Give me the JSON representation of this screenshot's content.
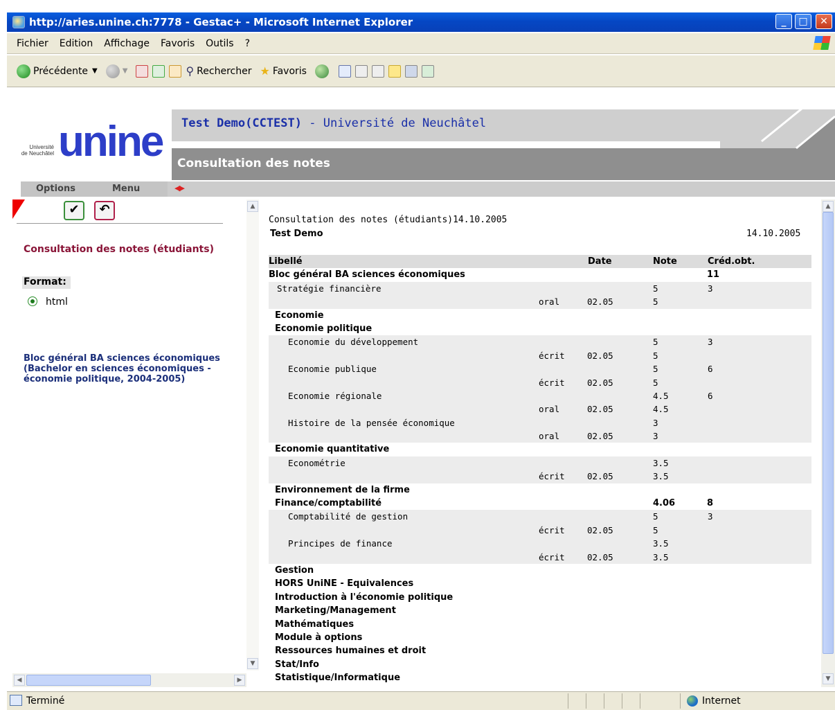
{
  "window": {
    "title": "http://aries.unine.ch:7778 - Gestac+ - Microsoft Internet Explorer"
  },
  "menu": [
    "Fichier",
    "Edition",
    "Affichage",
    "Favoris",
    "Outils",
    "?"
  ],
  "toolbar": {
    "back": "Précédente",
    "search": "Rechercher",
    "favorites": "Favoris"
  },
  "header": {
    "logo_small_line1": "Université",
    "logo_small_line2": "de Neuchâtel",
    "logo_big": "unine",
    "school_user": "Test Demo(CCTEST)",
    "school_sep": " - ",
    "school_name": "Université de Neuchâtel",
    "page_heading": "Consultation des notes"
  },
  "options_bar": {
    "options": "Options",
    "menu": "Menu"
  },
  "left_panel": {
    "heading": "Consultation des notes (étudiants)",
    "format_label": "Format:",
    "format_value": "html",
    "bloc_link": "Bloc général BA sciences économiques (Bachelor en sciences économiques - économie politique, 2004-2005)"
  },
  "report": {
    "title": "Consultation des notes (étudiants)14.10.2005",
    "student": "Test Demo",
    "date": "14.10.2005",
    "columns": {
      "libelle": "Libellé",
      "date": "Date",
      "note": "Note",
      "credits": "Créd.obt."
    },
    "rows": [
      {
        "type": "sec0",
        "label": "Bloc général BA sciences économiques",
        "type2": "",
        "date": "",
        "note": "",
        "credits": "11"
      },
      {
        "type": "item1",
        "label": "Stratégie financière",
        "type2": "",
        "date": "",
        "note": "5",
        "credits": "3"
      },
      {
        "type": "exam",
        "label": "",
        "type2": "oral",
        "date": "02.05",
        "note": "5",
        "credits": ""
      },
      {
        "type": "sec1",
        "label": "Economie",
        "type2": "",
        "date": "",
        "note": "",
        "credits": ""
      },
      {
        "type": "sec1",
        "label": "Economie politique",
        "type2": "",
        "date": "",
        "note": "",
        "credits": ""
      },
      {
        "type": "item2",
        "label": "Economie du développement",
        "type2": "",
        "date": "",
        "note": "5",
        "credits": "3"
      },
      {
        "type": "exam",
        "label": "",
        "type2": "écrit",
        "date": "02.05",
        "note": "5",
        "credits": ""
      },
      {
        "type": "item2",
        "label": "Economie publique",
        "type2": "",
        "date": "",
        "note": "5",
        "credits": "6"
      },
      {
        "type": "exam",
        "label": "",
        "type2": "écrit",
        "date": "02.05",
        "note": "5",
        "credits": ""
      },
      {
        "type": "item2",
        "label": "Economie régionale",
        "type2": "",
        "date": "",
        "note": "4.5",
        "credits": "6"
      },
      {
        "type": "exam",
        "label": "",
        "type2": "oral",
        "date": "02.05",
        "note": "4.5",
        "credits": ""
      },
      {
        "type": "item2",
        "label": "Histoire de la pensée économique",
        "type2": "",
        "date": "",
        "note": "3",
        "credits": ""
      },
      {
        "type": "exam",
        "label": "",
        "type2": "oral",
        "date": "02.05",
        "note": "3",
        "credits": ""
      },
      {
        "type": "sec1",
        "label": "Economie quantitative",
        "type2": "",
        "date": "",
        "note": "",
        "credits": ""
      },
      {
        "type": "item2",
        "label": "Econométrie",
        "type2": "",
        "date": "",
        "note": "3.5",
        "credits": ""
      },
      {
        "type": "exam",
        "label": "",
        "type2": "écrit",
        "date": "02.05",
        "note": "3.5",
        "credits": ""
      },
      {
        "type": "sec1",
        "label": "Environnement de la firme",
        "type2": "",
        "date": "",
        "note": "",
        "credits": ""
      },
      {
        "type": "sec1",
        "label": "Finance/comptabilité",
        "type2": "",
        "date": "",
        "note": "4.06",
        "credits": "8"
      },
      {
        "type": "item2",
        "label": "Comptabilité de gestion",
        "type2": "",
        "date": "",
        "note": "5",
        "credits": "3"
      },
      {
        "type": "exam",
        "label": "",
        "type2": "écrit",
        "date": "02.05",
        "note": "5",
        "credits": ""
      },
      {
        "type": "item2",
        "label": "Principes de finance",
        "type2": "",
        "date": "",
        "note": "3.5",
        "credits": ""
      },
      {
        "type": "exam",
        "label": "",
        "type2": "écrit",
        "date": "02.05",
        "note": "3.5",
        "credits": ""
      },
      {
        "type": "sec1",
        "label": "Gestion",
        "type2": "",
        "date": "",
        "note": "",
        "credits": ""
      },
      {
        "type": "sec1",
        "label": "HORS UniNE - Equivalences",
        "type2": "",
        "date": "",
        "note": "",
        "credits": ""
      },
      {
        "type": "sec1",
        "label": "Introduction à l'économie politique",
        "type2": "",
        "date": "",
        "note": "",
        "credits": ""
      },
      {
        "type": "sec1",
        "label": "Marketing/Management",
        "type2": "",
        "date": "",
        "note": "",
        "credits": ""
      },
      {
        "type": "sec1",
        "label": "Mathématiques",
        "type2": "",
        "date": "",
        "note": "",
        "credits": ""
      },
      {
        "type": "sec1",
        "label": "Module à options",
        "type2": "",
        "date": "",
        "note": "",
        "credits": ""
      },
      {
        "type": "sec1",
        "label": "Ressources humaines et droit",
        "type2": "",
        "date": "",
        "note": "",
        "credits": ""
      },
      {
        "type": "sec1",
        "label": "Stat/Info",
        "type2": "",
        "date": "",
        "note": "",
        "credits": ""
      },
      {
        "type": "sec1",
        "label": "Statistique/Informatique",
        "type2": "",
        "date": "",
        "note": "",
        "credits": ""
      }
    ]
  },
  "status": {
    "text": "Terminé",
    "zone": "Internet"
  },
  "colors": {
    "title_blue": "#1a2fa8",
    "accent_red": "#8a1538",
    "link_blue": "#1b2f7a"
  }
}
